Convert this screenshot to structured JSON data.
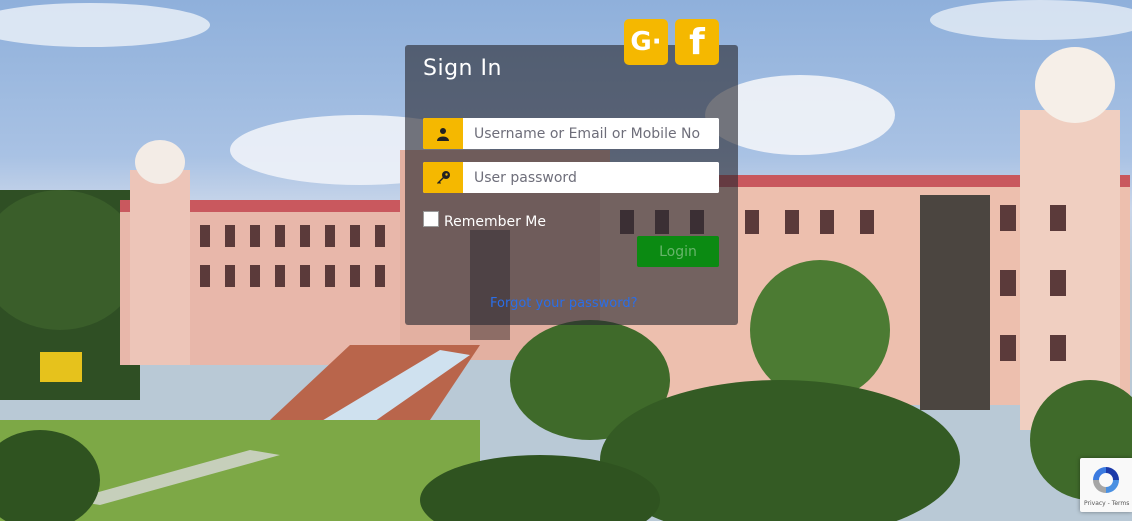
{
  "signin": {
    "title": "Sign In",
    "username_placeholder": "Username or Email or Mobile No",
    "password_placeholder": "User password",
    "remember_label": "Remember Me",
    "login_label": "Login",
    "forgot_link": "Forgot your password?"
  },
  "social": {
    "google_icon": "G·",
    "facebook_icon": "f"
  },
  "recaptcha": {
    "footer": "Privacy - Terms"
  },
  "icons": {
    "user": "user-icon",
    "key": "key-icon"
  },
  "colors": {
    "accent": "#f5b800",
    "login_button": "#0b8a12",
    "link": "#2a6ee8",
    "panel": "rgba(40,40,48,0.62)"
  }
}
